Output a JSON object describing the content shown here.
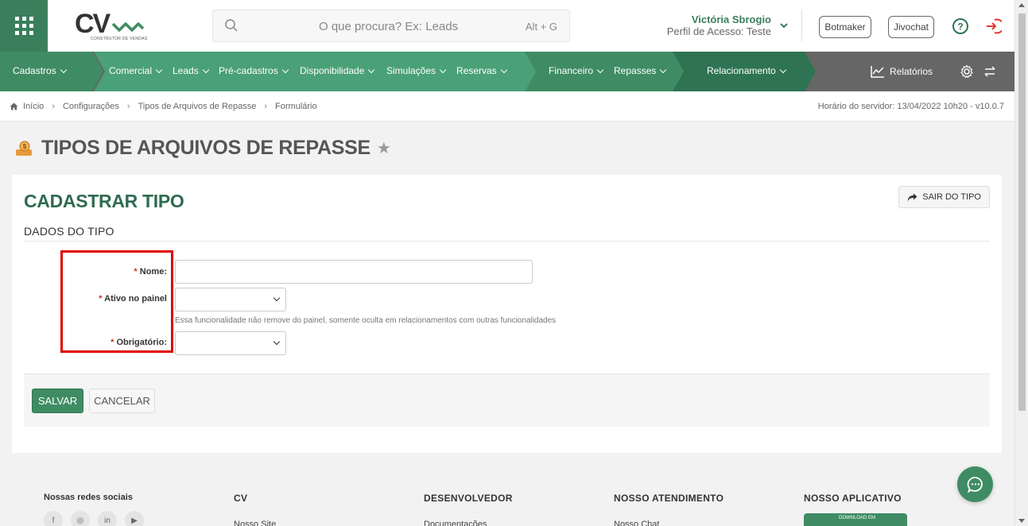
{
  "header": {
    "logo_text": "CV",
    "logo_tagline": "CONSTRUTOR DE VENDAS",
    "search_placeholder": "O que procura? Ex: Leads",
    "search_shortcut": "Alt + G",
    "user_name": "Victória Sbrogio",
    "user_role": "Perfil de Acesso: Teste",
    "botmaker_label": "Botmaker",
    "jivochat_label": "Jivochat",
    "icons": [
      "apps-grid-icon",
      "search-icon",
      "chevron-down-icon",
      "help-icon",
      "logout-icon"
    ]
  },
  "nav": {
    "items": [
      {
        "label": "Cadastros"
      },
      {
        "label": "Comercial"
      },
      {
        "label": "Leads"
      },
      {
        "label": "Pré-cadastros"
      },
      {
        "label": "Disponibilidade"
      },
      {
        "label": "Simulações"
      },
      {
        "label": "Reservas"
      },
      {
        "label": "Financeiro"
      },
      {
        "label": "Repasses"
      },
      {
        "label": "Relacionamento"
      }
    ],
    "reports_label": "Relatórios",
    "colors": {
      "segment_dark": "#3f8c64",
      "segment_light": "#4aa077",
      "segment_darker": "#2e7452",
      "rest": "#666666"
    }
  },
  "breadcrumb": {
    "items": [
      "Início",
      "Configurações",
      "Tipos de Arquivos de Repasse",
      "Formulário"
    ],
    "server_time": "Horário do servidor: 13/04/2022 10h20 - v10.0.7"
  },
  "page": {
    "title": "TIPOS DE ARQUIVOS DE REPASSE"
  },
  "form": {
    "card_title": "CADASTRAR TIPO",
    "exit_label": "SAIR DO TIPO",
    "section_title": "DADOS DO TIPO",
    "required_mark": "*",
    "fields": {
      "nome": {
        "label": "Nome:",
        "value": ""
      },
      "ativo": {
        "label": "Ativo no painel",
        "value": "",
        "help": "Essa funcionalidade não remove do painel, somente oculta em relacionamentos com outras funcionalidades"
      },
      "obrigatorio": {
        "label": "Obrigatório:",
        "value": ""
      }
    },
    "save_label": "SALVAR",
    "cancel_label": "CANCELAR",
    "highlight_color": "#e00000"
  },
  "footer": {
    "social_title": "Nossas redes sociais",
    "socials": [
      "f",
      "◎",
      "in",
      "▶"
    ],
    "cv_title": "CV",
    "cv_link": "Nosso Site",
    "dev_title": "DESENVOLVEDOR",
    "dev_link": "Documentações",
    "support_title": "NOSSO ATENDIMENTO",
    "support_link": "Nosso Chat",
    "app_title": "NOSSO APLICATIVO",
    "store_badge": "DOWNLOAD EM"
  }
}
